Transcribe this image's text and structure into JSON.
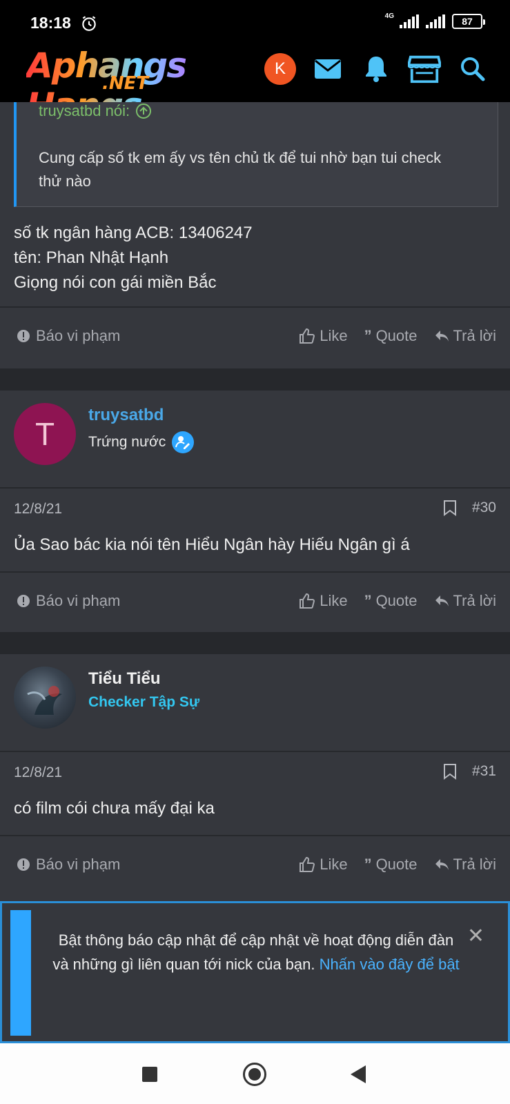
{
  "status_bar": {
    "time": "18:18",
    "network": "4G",
    "battery": "87"
  },
  "header": {
    "logo_text": "Aphangs Hangs",
    "logo_sub": ".NET",
    "user_initial": "K"
  },
  "post1": {
    "quote_author": "truysatbd nói:",
    "quote_text": "Cung cấp số tk em ấy vs tên chủ tk để tui nhờ bạn tui check thử nào",
    "body_lines": [
      "số tk ngân hàng ACB: 13406247",
      "tên: Phan Nhật Hạnh",
      "Giọng nói con gái miền Bắc"
    ]
  },
  "actions": {
    "report": "Báo vi phạm",
    "like": "Like",
    "quote": "Quote",
    "reply": "Trả lời"
  },
  "post2": {
    "user_initial": "T",
    "username": "truysatbd",
    "user_title": "Trứng nước",
    "date": "12/8/21",
    "number": "#30",
    "body": "Ủa Sao bác kia nói tên Hiểu Ngân hày Hiếu Ngân gì á"
  },
  "post3": {
    "username": "Tiểu Tiểu",
    "user_title": "Checker Tập Sự",
    "date": "12/8/21",
    "number": "#31",
    "body": "có film cói chưa mấy đại ka"
  },
  "notification": {
    "text": "Bật thông báo cập nhật để cập nhật về hoạt động diễn đàn và những gì liên quan tới nick của bạn.",
    "link": "Nhấn vào đây để bật",
    "close": "✕"
  },
  "colors": {
    "accent": "#2ea6ff",
    "username_blue": "#4aa8e8",
    "checker_cyan": "#33c7f0",
    "quote_green": "#7cbf6a",
    "avatar_t": "#8e1452",
    "avatar_k": "#f05522"
  }
}
